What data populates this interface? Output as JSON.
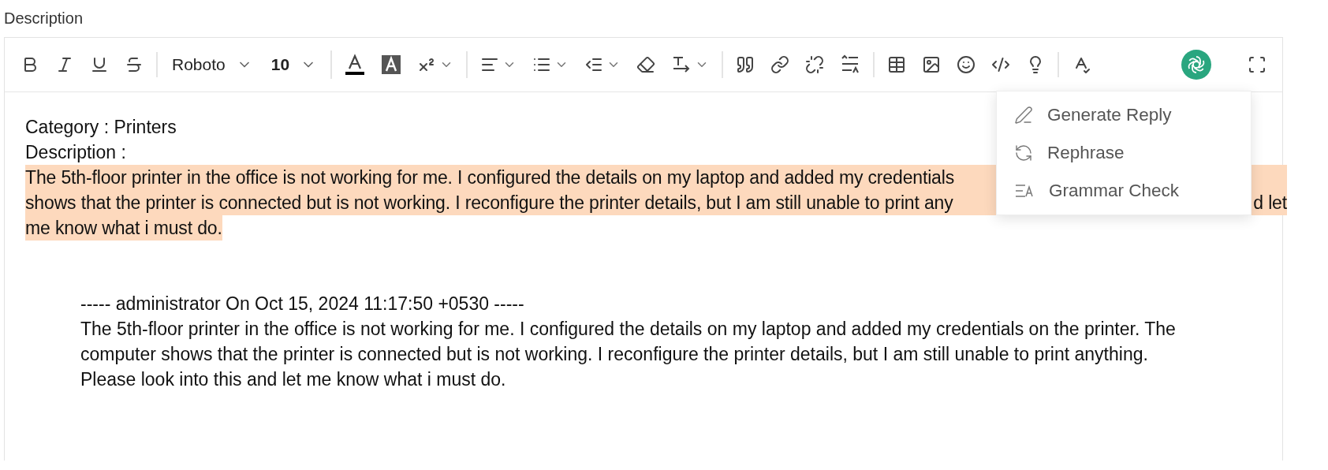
{
  "field_label": "Description",
  "toolbar": {
    "groups": [
      [
        {
          "kind": "icon"
        },
        {
          "kind": "icon"
        },
        {
          "kind": "icon"
        },
        {
          "kind": "icon"
        }
      ],
      [
        {
          "kind": "select",
          "value": "Roboto"
        },
        {
          "kind": "select",
          "value": "10",
          "bold": true
        }
      ],
      [
        {
          "kind": "icon"
        },
        {
          "kind": "icon"
        },
        {
          "kind": "icon_dropdown"
        }
      ],
      [
        {
          "kind": "icon_dropdown"
        },
        {
          "kind": "icon_dropdown"
        },
        {
          "kind": "icon_dropdown"
        },
        {
          "kind": "icon"
        },
        {
          "kind": "icon_dropdown"
        }
      ],
      [
        {
          "kind": "icon"
        },
        {
          "kind": "icon"
        },
        {
          "kind": "icon"
        },
        {
          "kind": "icon"
        }
      ],
      [
        {
          "kind": "icon"
        },
        {
          "kind": "icon"
        },
        {
          "kind": "icon"
        },
        {
          "kind": "icon"
        },
        {
          "kind": "icon"
        }
      ],
      [
        {
          "kind": "icon"
        }
      ]
    ],
    "assistant": {
      "kind": "ai"
    },
    "fullscreen": {
      "kind": "icon"
    }
  },
  "content": {
    "lines": [
      "Category : Printers",
      "Description :"
    ],
    "highlighted_lines": [
      {
        "text": "The 5th-floor printer in the office is not working for me. I configured the details on my laptop and added my credentials"
      },
      {
        "text": "shows that the printer is connected but is not working. I reconfigure the printer details, but I am still unable to print any",
        "end": "d let"
      },
      {
        "text": "me know what i must do."
      }
    ],
    "quote": {
      "header": "----- administrator On Oct 15, 2024 11:17:50 +0530 -----",
      "body": [
        "The 5th-floor printer in the office is not working for me. I configured the details on my laptop and added my credentials on the printer. The",
        "computer shows that the printer is connected but is not working. I reconfigure the printer details, but I am still unable to print anything.",
        "Please look into this and let me know what i must do."
      ]
    }
  },
  "ai_menu": {
    "items": [
      {
        "label": "Generate Reply"
      },
      {
        "label": "Rephrase"
      },
      {
        "label": "Grammar Check"
      }
    ]
  }
}
